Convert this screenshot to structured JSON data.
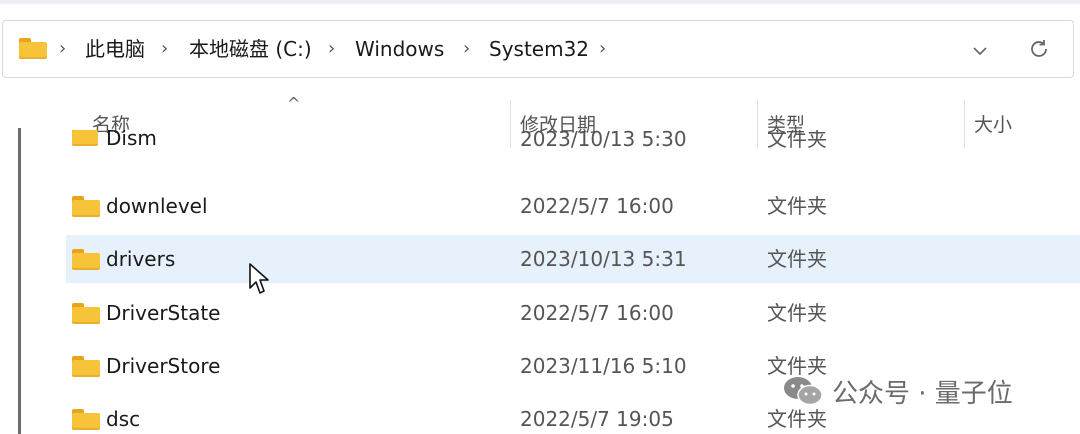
{
  "address_bar": {
    "crumbs": [
      "此电脑",
      "本地磁盘 (C:)",
      "Windows",
      "System32"
    ],
    "separator": "›"
  },
  "header": {
    "name": "名称",
    "date": "修改日期",
    "type": "类型",
    "size": "大小",
    "sort_indicator": "^"
  },
  "rows": [
    {
      "name": "Dism",
      "date": "2023/10/13 5:30",
      "type": "文件夹"
    },
    {
      "name": "downlevel",
      "date": "2022/5/7 16:00",
      "type": "文件夹"
    },
    {
      "name": "drivers",
      "date": "2023/10/13 5:31",
      "type": "文件夹",
      "hovered": true
    },
    {
      "name": "DriverState",
      "date": "2022/5/7 16:00",
      "type": "文件夹"
    },
    {
      "name": "DriverStore",
      "date": "2023/11/16 5:10",
      "type": "文件夹"
    },
    {
      "name": "dsc",
      "date": "2022/5/7 19:05",
      "type": "文件夹"
    }
  ],
  "watermark": {
    "text": "公众号 · 量子位",
    "icon": "wechat-icon"
  },
  "icons": {
    "folder": "folder-icon",
    "chevron": "chevron-down-icon",
    "refresh": "refresh-icon",
    "cursor": "mouse-pointer-icon"
  },
  "colors": {
    "folder": "#f7c338",
    "selected_row": "#e6f1fb"
  }
}
